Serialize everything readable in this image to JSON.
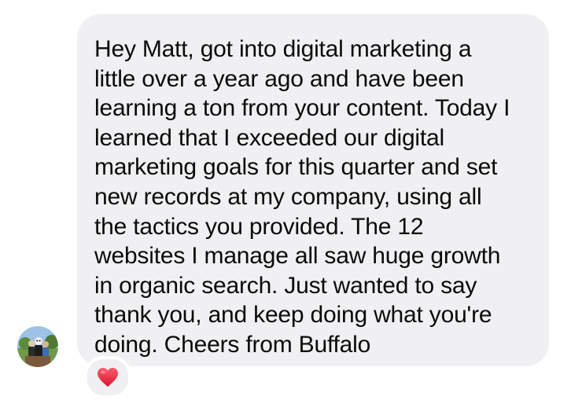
{
  "message": {
    "text": "Hey Matt, got into digital marketing a\nlittle over a year ago and have been\nlearning a ton from your content. Today I\nlearned that I exceeded our digital\nmarketing goals for this quarter and set\nnew records at my company, using all\nthe tactics you provided. The 12\nwebsites I manage all saw huge growth\nin organic search. Just wanted to say\nthank you, and keep doing what you're\ndoing. Cheers from Buffalo",
    "bubble_color": "#f0f0f2",
    "text_color": "#0a0a0a"
  },
  "sender": {
    "avatar_icon": "profile-photo-avatar"
  },
  "reaction": {
    "icon": "red-heart-icon",
    "color": "#e0243c"
  }
}
